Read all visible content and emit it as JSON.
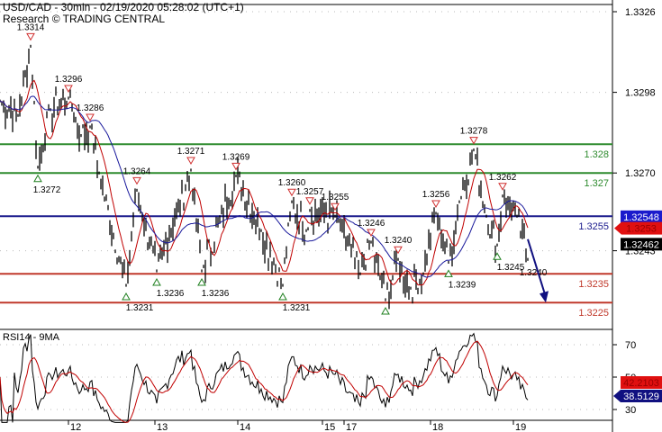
{
  "chart_data": {
    "type": "candlestick",
    "title": "USD/CAD - 30min - 02/19/2020 05:28:02 (UTC+1)",
    "subtitle": "Research © TRADING CENTRAL",
    "price_axis": {
      "ticks": [
        "1.3326",
        "1.3298",
        "1.3270",
        "1.3243"
      ],
      "range": [
        1.3216,
        1.333
      ]
    },
    "x_tick_labels": [
      {
        "label": "12",
        "bar": 38
      },
      {
        "label": "13",
        "bar": 86
      },
      {
        "label": "14",
        "bar": 132
      },
      {
        "label": "15",
        "bar": 179
      },
      {
        "label": "17",
        "bar": 191
      },
      {
        "label": "18",
        "bar": 239
      },
      {
        "label": "19",
        "bar": 285
      }
    ],
    "price_path": [
      [
        0,
        1.3295
      ],
      [
        10,
        1.329
      ],
      [
        17,
        1.3314
      ],
      [
        21,
        1.3272
      ],
      [
        28,
        1.3292
      ],
      [
        38,
        1.3296
      ],
      [
        45,
        1.3283
      ],
      [
        50,
        1.3286
      ],
      [
        55,
        1.327
      ],
      [
        70,
        1.3231
      ],
      [
        76,
        1.3264
      ],
      [
        87,
        1.3236
      ],
      [
        106,
        1.3271
      ],
      [
        112,
        1.3236
      ],
      [
        131,
        1.3269
      ],
      [
        145,
        1.325
      ],
      [
        157,
        1.3231
      ],
      [
        162,
        1.326
      ],
      [
        170,
        1.325
      ],
      [
        172,
        1.3257
      ],
      [
        186,
        1.3255
      ],
      [
        200,
        1.3235
      ],
      [
        206,
        1.3246
      ],
      [
        214,
        1.3226
      ],
      [
        221,
        1.324
      ],
      [
        228,
        1.323
      ],
      [
        235,
        1.3235
      ],
      [
        242,
        1.3256
      ],
      [
        249,
        1.3239
      ],
      [
        255,
        1.326
      ],
      [
        263,
        1.3278
      ],
      [
        270,
        1.3255
      ],
      [
        276,
        1.3245
      ],
      [
        279,
        1.3262
      ],
      [
        287,
        1.3255
      ],
      [
        293,
        1.324
      ]
    ],
    "levels": [
      {
        "value": 1.328,
        "label": "1.328",
        "color": "#2e8b2e"
      },
      {
        "value": 1.327,
        "label": "1.327",
        "color": "#2e8b2e"
      },
      {
        "value": 1.3255,
        "label": "1.3255",
        "color": "#1a1a8c"
      },
      {
        "value": 1.3235,
        "label": "1.3235",
        "color": "#c0392b"
      },
      {
        "value": 1.3225,
        "label": "1.3225",
        "color": "#c0392b"
      }
    ],
    "highs": [
      {
        "bar": 17,
        "value": 1.3314,
        "label": "1.3314"
      },
      {
        "bar": 38,
        "value": 1.3296,
        "label": "1.3296"
      },
      {
        "bar": 50,
        "value": 1.3286,
        "label": "1.3286"
      },
      {
        "bar": 76,
        "value": 1.3264,
        "label": "1.3264"
      },
      {
        "bar": 106,
        "value": 1.3271,
        "label": "1.3271"
      },
      {
        "bar": 131,
        "value": 1.3269,
        "label": "1.3269"
      },
      {
        "bar": 162,
        "value": 1.326,
        "label": "1.3260"
      },
      {
        "bar": 172,
        "value": 1.3257,
        "label": "1.3257"
      },
      {
        "bar": 186,
        "value": 1.3255,
        "label": "1.3255"
      },
      {
        "bar": 206,
        "value": 1.3246,
        "label": "1.3246"
      },
      {
        "bar": 221,
        "value": 1.324,
        "label": "1.3240"
      },
      {
        "bar": 242,
        "value": 1.3256,
        "label": "1.3256"
      },
      {
        "bar": 263,
        "value": 1.3278,
        "label": "1.3278"
      },
      {
        "bar": 279,
        "value": 1.3262,
        "label": "1.3262"
      }
    ],
    "lows": [
      {
        "bar": 21,
        "value": 1.3272,
        "label": "1.3272"
      },
      {
        "bar": 70,
        "value": 1.3231,
        "label": "1.3231"
      },
      {
        "bar": 87,
        "value": 1.3236,
        "label": "1.3236"
      },
      {
        "bar": 112,
        "value": 1.3236,
        "label": "1.3236"
      },
      {
        "bar": 157,
        "value": 1.3231,
        "label": "1.3231"
      },
      {
        "bar": 214,
        "value": 1.3226,
        "label": ""
      },
      {
        "bar": 249,
        "value": 1.3239,
        "label": "1.3239"
      },
      {
        "bar": 276,
        "value": 1.3245,
        "label": "1.3245"
      }
    ],
    "forecast_label": {
      "bar": 295,
      "value": 1.324,
      "label": "1.3240"
    },
    "forecast_arrow": {
      "from": [
        293,
        1.3247
      ],
      "to": [
        303,
        1.3225
      ]
    },
    "price_tags": [
      {
        "value": 1.32548,
        "label": "1.32548",
        "color": "#1a1acc"
      },
      {
        "value": 1.3253,
        "label": "1.3253",
        "color": "#e01010"
      },
      {
        "value": 1.32462,
        "label": "1.32462",
        "color": "#000000"
      }
    ],
    "rsi": {
      "title": "RSI14 - 9MA",
      "ticks": [
        "70",
        "50",
        "30"
      ],
      "range": [
        22,
        78
      ],
      "tags": [
        {
          "value": 42.2103,
          "label": "42.2103",
          "color": "#e01010"
        },
        {
          "value": 38.5129,
          "label": "38.5129",
          "color": "#101080"
        }
      ]
    }
  }
}
